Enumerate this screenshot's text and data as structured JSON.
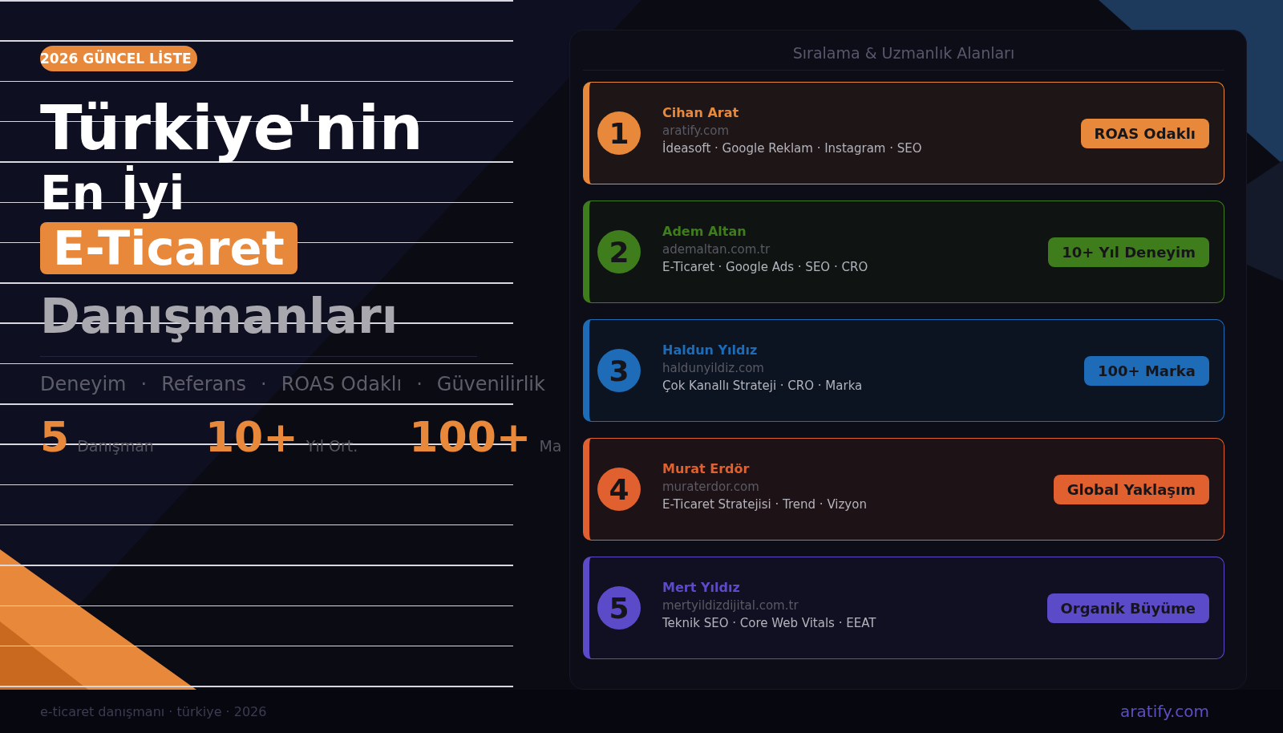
{
  "badge": "2026 GÜNCEL LİSTE",
  "title": {
    "line_1": "Türkiye'nin",
    "line_2": "En İyi",
    "highlight": "E-Ticaret",
    "line_4": "Danışmanları"
  },
  "tagline": [
    "Deneyim",
    "·",
    "Referans",
    "·",
    "ROAS Odaklı",
    "·",
    "Güvenilirlik"
  ],
  "stats": [
    {
      "value": "5",
      "label": "Danışman"
    },
    {
      "value": "10+",
      "label": "Yıl Ort."
    },
    {
      "value": "100+",
      "label": "Ma"
    }
  ],
  "panel": {
    "title": "Sıralama & Uzmanlık Alanları",
    "consultants": [
      {
        "rank": "1",
        "name": "Cihan Arat",
        "site": "aratify.com",
        "skills": "İdeasoft · Google Reklam · Instagram · SEO",
        "tag": "ROAS Odaklı",
        "color": "#e8883a"
      },
      {
        "rank": "2",
        "name": "Adem Altan",
        "site": "ademaltan.com.tr",
        "skills": "E-Ticaret · Google Ads · SEO · CRO",
        "tag": "10+ Yıl Deneyim",
        "color": "#3f7d1c"
      },
      {
        "rank": "3",
        "name": "Haldun Yıldız",
        "site": "haldunyildiz.com",
        "skills": "Çok Kanallı Strateji · CRO · Marka",
        "tag": "100+ Marka",
        "color": "#1e6bb8"
      },
      {
        "rank": "4",
        "name": "Murat Erdör",
        "site": "muraterdor.com",
        "skills": "E-Ticaret Stratejisi · Trend · Vizyon",
        "tag": "Global Yaklaşım",
        "color": "#e0602f"
      },
      {
        "rank": "5",
        "name": "Mert Yıldız",
        "site": "mertyildizdijital.com.tr",
        "skills": "Teknik SEO · Core Web Vitals · EEAT",
        "tag": "Organik Büyüme",
        "color": "#5b4bc8"
      }
    ]
  },
  "footer": {
    "caption": "e-ticaret danışmanı · türkiye · 2026",
    "site": "aratify.com"
  }
}
